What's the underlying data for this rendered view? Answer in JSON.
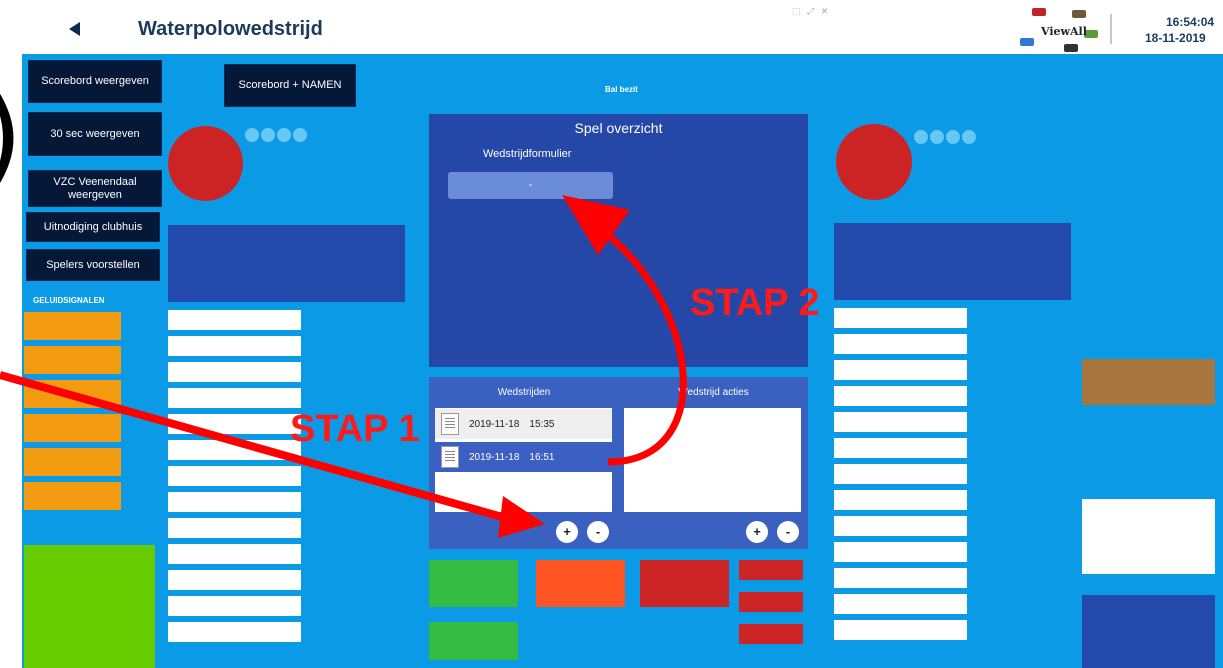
{
  "window": {
    "title": "Waterpolowedstrijd",
    "mini_icons": "⬚ ⤢ ✕",
    "viewall_label": "ViewAll",
    "clock_time": "16:54:04",
    "clock_date": "18-11-2019",
    "back_icon": "back-arrow-icon"
  },
  "left_buttons": {
    "scoreboard": "Scorebord weergeven",
    "sec30": "30 sec weergeven",
    "vzc": "VZC Veenendaal weergeven",
    "invite": "Uitnodiging clubhuis",
    "players": "Spelers voorstellen",
    "scoreboard_names": "Scorebord + NAMEN"
  },
  "labels": {
    "ball_possession": "Bal bezit",
    "sound_signals": "GELUIDSIGNALEN"
  },
  "overview": {
    "title": "Spel overzicht",
    "form_label": "Wedstrijdformulier",
    "form_value": "-"
  },
  "matches": {
    "matches_heading": "Wedstrijden",
    "actions_heading": "Wedstrijd acties",
    "rows": [
      {
        "date": "2019-11-18",
        "time": "15:35"
      },
      {
        "date": "2019-11-18",
        "time": "16:51"
      }
    ],
    "add": "+",
    "remove": "-"
  },
  "annotations": {
    "step1": "STAP 1",
    "step2": "STAP 2",
    "paren": ")"
  },
  "colors": {
    "main_bg": "#0b9be6",
    "navy": "#2349ac",
    "dark_button": "#061838",
    "orange_signal": "#f29b11",
    "red": "#cc2424",
    "annotation_red": "#ff1a1a"
  }
}
